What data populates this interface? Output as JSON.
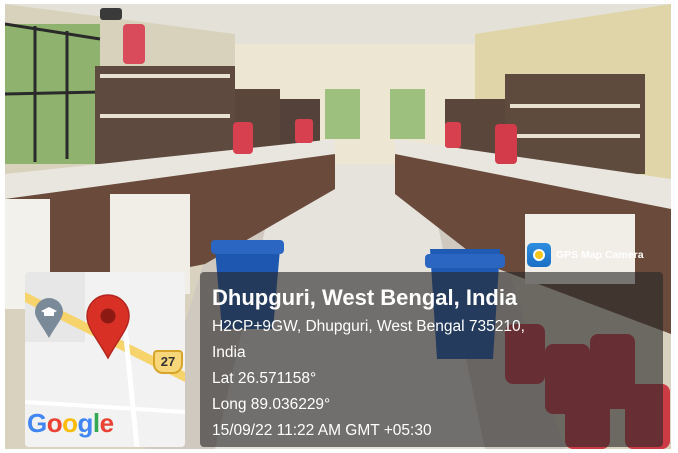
{
  "overlay": {
    "badge_label": "GPS Map Camera",
    "place_title": "Dhupguri, West Bengal, India",
    "address_line_1": "H2CP+9GW, Dhupguri, West Bengal 735210,",
    "address_line_2": "India",
    "latitude": "Lat 26.571158°",
    "longitude": "Long 89.036229°",
    "datetime": "15/09/22 11:22 AM GMT +05:30"
  },
  "map": {
    "road_number": "27",
    "logo_text": "Google"
  },
  "colors": {
    "panel_bg": "#282828",
    "pin_red": "#d93025",
    "road_yellow": "#f7d77a",
    "badge_blue": "#1a6fc4"
  },
  "icons": [
    "map-pin-icon",
    "education-pin-icon",
    "gps-camera-icon"
  ]
}
